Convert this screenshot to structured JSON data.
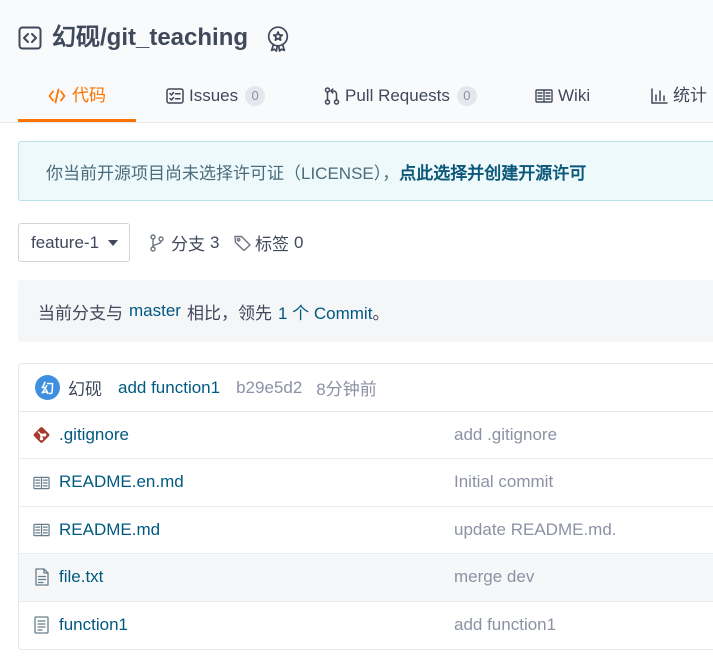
{
  "repo": {
    "title": "幻砚/git_teaching",
    "repo_icon": "repo-code-icon",
    "badge_icon": "award-badge-icon"
  },
  "tabs": [
    {
      "label": "代码",
      "icon": "code-icon",
      "active": true
    },
    {
      "label": "Issues",
      "count": "0",
      "icon": "issues-icon"
    },
    {
      "label": "Pull Requests",
      "count": "0",
      "icon": "pull-request-icon"
    },
    {
      "label": "Wiki",
      "icon": "wiki-book-icon"
    },
    {
      "label": "统计",
      "icon": "stats-chart-icon"
    }
  ],
  "license_notice": {
    "text": "你当前开源项目尚未选择许可证（LICENSE），",
    "link": "点此选择并创建开源许可"
  },
  "branch_bar": {
    "current_branch": "feature-1",
    "dropdown_icon": "chevron-down-icon",
    "branches": {
      "label": "分支",
      "count": "3",
      "icon": "branch-icon"
    },
    "tags": {
      "label": "标签",
      "count": "0",
      "icon": "tag-icon"
    }
  },
  "compare": {
    "prefix": "当前分支与",
    "base_branch": "master",
    "middle": "相比，领先",
    "ahead": "1 个 Commit",
    "suffix": "。"
  },
  "latest_commit": {
    "avatar_initial": "幻",
    "author": "幻砚",
    "message": "add function1",
    "sha": "b29e5d2",
    "time": "8分钟前"
  },
  "files": [
    {
      "name": ".gitignore",
      "icon": "git-icon",
      "commit": "add .gitignore"
    },
    {
      "name": "README.en.md",
      "icon": "readme-book-icon",
      "commit": "Initial commit"
    },
    {
      "name": "README.md",
      "icon": "readme-book-icon",
      "commit": "update README.md."
    },
    {
      "name": "file.txt",
      "icon": "file-text-icon",
      "commit": "merge dev",
      "hovered": true
    },
    {
      "name": "function1",
      "icon": "file-icon",
      "commit": "add function1"
    }
  ],
  "colors": {
    "accent": "#fe7300",
    "link": "#005980",
    "text": "#40485b",
    "muted": "#8c92a4",
    "notice_bg": "#eef9fb",
    "avatar": "#3e8fdf"
  }
}
